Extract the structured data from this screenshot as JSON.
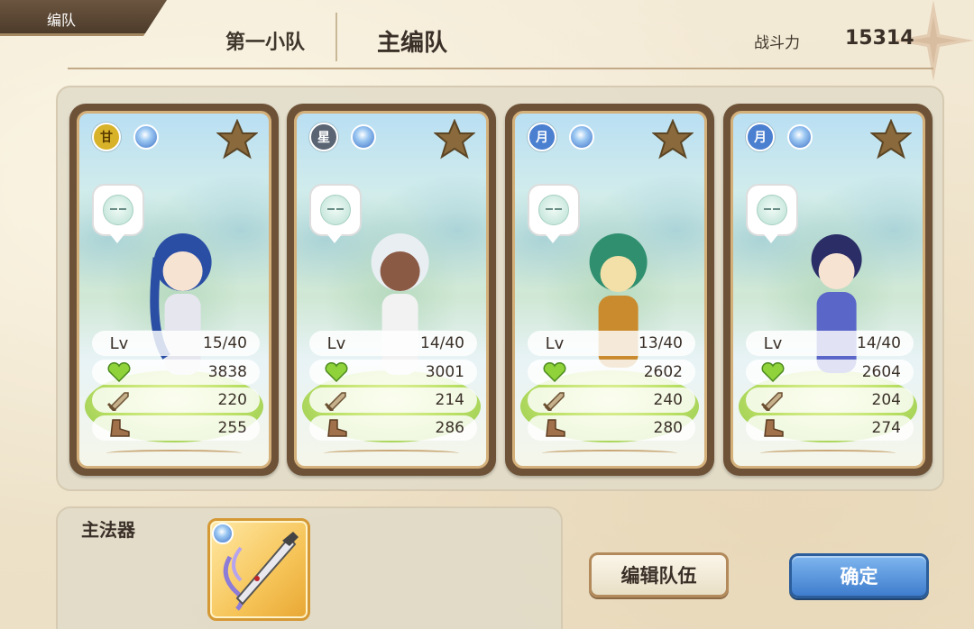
{
  "header": {
    "tab_label": "编队",
    "subteam_label": "第一小队",
    "mainteam_label": "主编队",
    "power_label": "战斗力",
    "power_value": "15314"
  },
  "cards": [
    {
      "badge": "甘",
      "badge_color": "#d8b32a",
      "level_label": "Lv",
      "level": "15/40",
      "hp": "3838",
      "atk": "220",
      "spd": "255",
      "hair_color": "#2b4ea5",
      "outfit_color": "#e6e6ef"
    },
    {
      "badge": "星",
      "badge_color": "#5a6472",
      "level_label": "Lv",
      "level": "14/40",
      "hp": "3001",
      "atk": "214",
      "spd": "286",
      "hair_color": "#e9eef3",
      "outfit_color": "#8b5a45"
    },
    {
      "badge": "月",
      "badge_color": "#4b7fd0",
      "level_label": "Lv",
      "level": "13/40",
      "hp": "2602",
      "atk": "240",
      "spd": "280",
      "hair_color": "#2f8f6f",
      "outfit_color": "#c98b2d"
    },
    {
      "badge": "月",
      "badge_color": "#4b7fd0",
      "level_label": "Lv",
      "level": "14/40",
      "hp": "2604",
      "atk": "204",
      "spd": "274",
      "hair_color": "#2b2d66",
      "outfit_color": "#5b66c9"
    }
  ],
  "artifact": {
    "label": "主法器"
  },
  "buttons": {
    "edit_label": "编辑队伍",
    "confirm_label": "确定"
  }
}
